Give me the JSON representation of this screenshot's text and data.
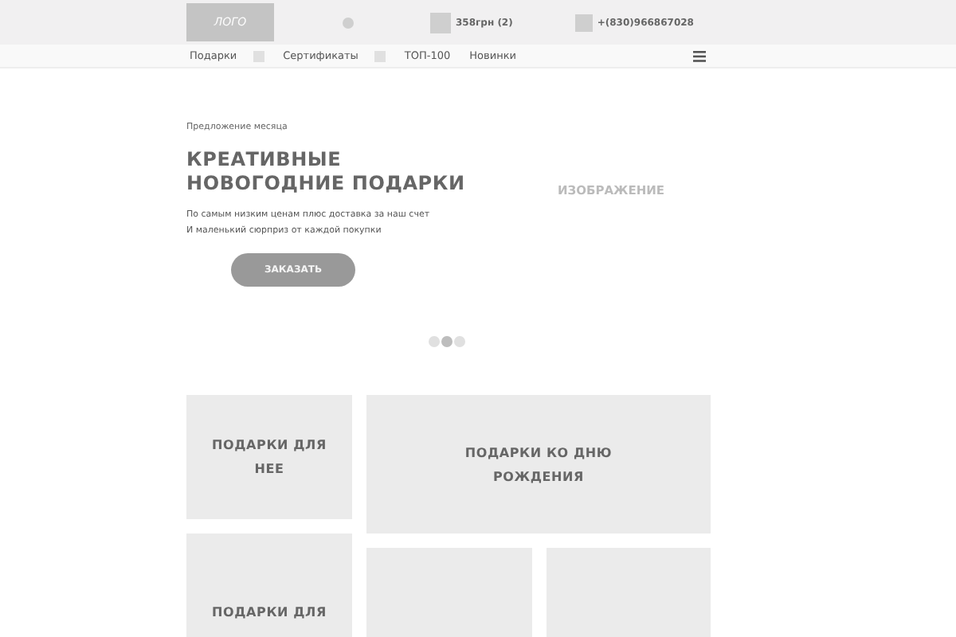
{
  "header": {
    "logo": "ЛОГО",
    "cart": "358грн (2)",
    "phone": "+(830)966867028"
  },
  "nav": {
    "items": [
      {
        "label": "Подарки",
        "icon_after": true
      },
      {
        "label": "Сертификаты",
        "icon_after": true
      },
      {
        "label": "ТОП-100",
        "icon_after": false
      },
      {
        "label": "Новинки",
        "icon_after": false
      }
    ]
  },
  "hero": {
    "eyebrow": "Предложение месяца",
    "title_lines": [
      "КРЕАТИВНЫЕ",
      "НОВОГОДНИЕ ПОДАРКИ"
    ],
    "description_lines": [
      "По самым низким ценам плюс доставка за наш счет",
      "И маленький сюрприз от каждой покупки"
    ],
    "button": "ЗАКАЗАТЬ",
    "image_label": "ИЗОБРАЖЕНИЕ",
    "dots": [
      {
        "selected": false
      },
      {
        "selected": true
      },
      {
        "selected": false
      }
    ]
  },
  "tiles": [
    {
      "kind": "titled",
      "title_lines": [
        "ПОДАРКИ ДЛЯ",
        "НЕЕ"
      ]
    },
    {
      "kind": "titled",
      "title_lines": [
        "ПОДАРКИ КО ДНЮ",
        "РОЖДЕНИЯ"
      ]
    },
    {
      "kind": "titled",
      "title_lines": [
        "ПОДАРКИ ДЛЯ"
      ]
    },
    {
      "kind": "blank"
    },
    {
      "kind": "blank"
    }
  ]
}
